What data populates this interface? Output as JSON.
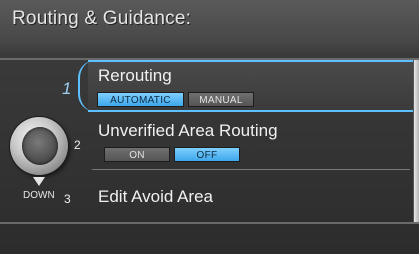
{
  "header": {
    "title": "Routing & Guidance:"
  },
  "controller": {
    "down_label": "DOWN",
    "numbers": [
      "1",
      "2",
      "3"
    ]
  },
  "menu": {
    "items": [
      {
        "label": "Rerouting",
        "options": [
          "AUTOMATIC",
          "MANUAL"
        ],
        "selected": "AUTOMATIC"
      },
      {
        "label": "Unverified Area Routing",
        "options": [
          "ON",
          "OFF"
        ],
        "selected": "OFF"
      },
      {
        "label": "Edit Avoid Area"
      }
    ]
  },
  "colors": {
    "highlight": "#5ec1ff",
    "selected_button": "#3ea7ea"
  }
}
